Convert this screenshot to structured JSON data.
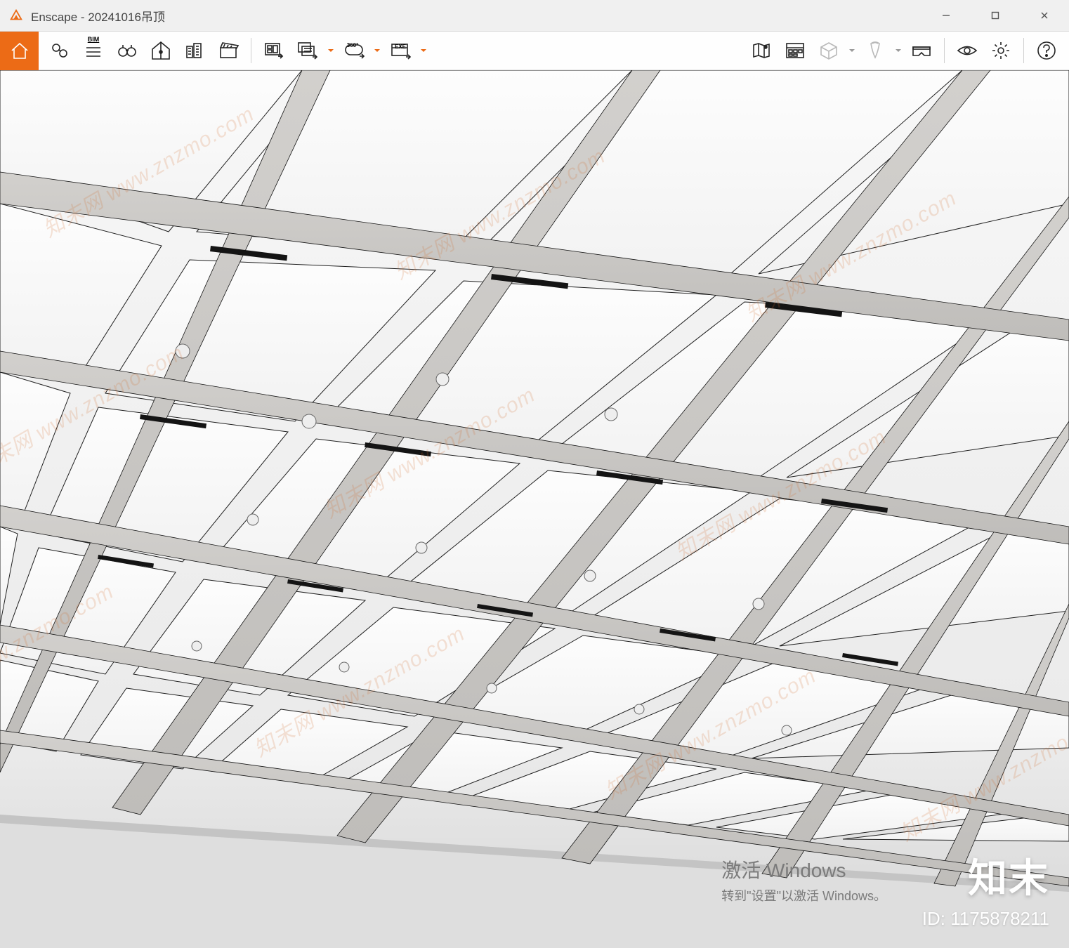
{
  "window": {
    "app_name": "Enscape",
    "document_name": "20241016吊顶",
    "title": "Enscape - 20241016吊顶"
  },
  "toolbar": {
    "bim_label": "BIM",
    "pano_label": "360°",
    "exe_label": "EXE"
  },
  "watermark": {
    "text_cn": "知末网",
    "url": "www.znzmo.com",
    "brand": "知末",
    "id_prefix": "ID: ",
    "id_value": "1175878211"
  },
  "activation": {
    "line1": "激活 Windows",
    "line2": "转到\"设置\"以激活 Windows。"
  },
  "colors": {
    "accent": "#ec6b16",
    "icon": "#232323",
    "toolbar_bg": "#fefefe"
  }
}
